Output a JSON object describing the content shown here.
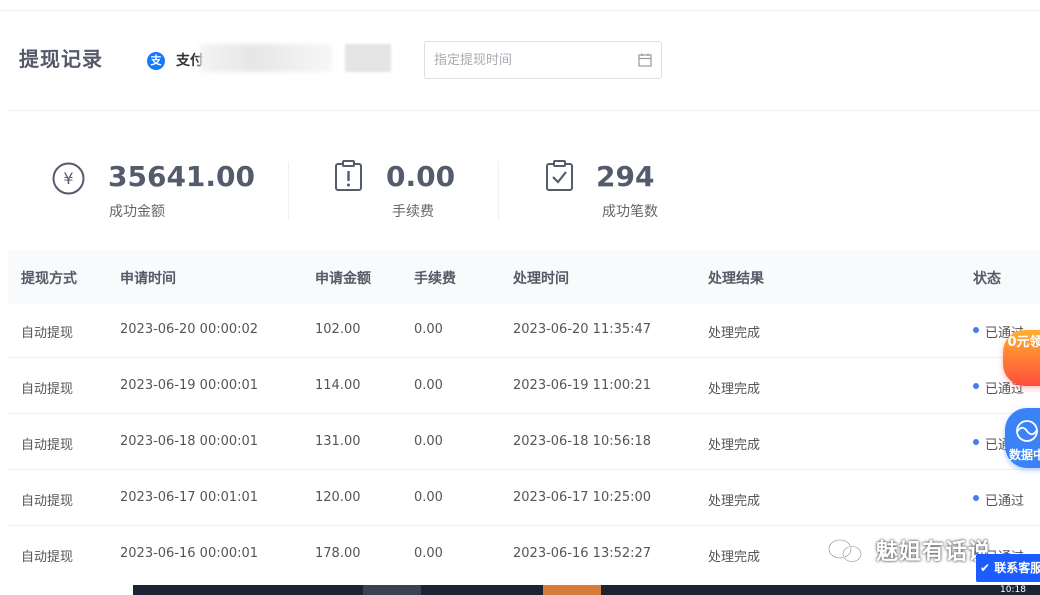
{
  "header": {
    "title": "提现记录",
    "account_label": "支付",
    "date_placeholder": "指定提现时间"
  },
  "stats": [
    {
      "value": "35641.00",
      "label": "成功金额",
      "icon": "yen-icon"
    },
    {
      "value": "0.00",
      "label": "手续费",
      "icon": "alert-clipboard-icon"
    },
    {
      "value": "294",
      "label": "成功笔数",
      "icon": "check-clipboard-icon"
    }
  ],
  "table": {
    "columns": [
      "提现方式",
      "申请时间",
      "申请金额",
      "手续费",
      "处理时间",
      "处理结果",
      "状态"
    ],
    "rows": [
      [
        "自动提现",
        "2023-06-20 00:00:02",
        "102.00",
        "0.00",
        "2023-06-20 11:35:47",
        "处理完成",
        "已通过"
      ],
      [
        "自动提现",
        "2023-06-19 00:00:01",
        "114.00",
        "0.00",
        "2023-06-19 11:00:21",
        "处理完成",
        "已通过"
      ],
      [
        "自动提现",
        "2023-06-18 00:00:01",
        "131.00",
        "0.00",
        "2023-06-18 10:56:18",
        "处理完成",
        "已通过"
      ],
      [
        "自动提现",
        "2023-06-17 00:01:01",
        "120.00",
        "0.00",
        "2023-06-17 10:25:00",
        "处理完成",
        "已通过"
      ],
      [
        "自动提现",
        "2023-06-16 00:00:01",
        "178.00",
        "0.00",
        "2023-06-16 13:52:27",
        "处理完成",
        "已通过"
      ]
    ]
  },
  "overlays": {
    "promo_text": "0元领",
    "data_badge": "数据中",
    "service_button": "联系客服",
    "watermark": "魅姐有话说"
  },
  "taskbar": {
    "clock": "10:18"
  },
  "colors": {
    "accent": "#4a7cf0",
    "header_bg": "#f9fafc",
    "title": "#555a66"
  }
}
